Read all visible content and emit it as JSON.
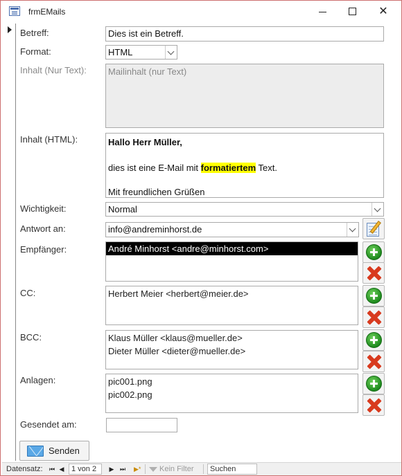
{
  "window": {
    "title": "frmEMails",
    "controls": {
      "minimize": "minimize",
      "maximize": "maximize",
      "close": "✕"
    }
  },
  "form": {
    "betreff": {
      "label": "Betreff:",
      "value": "Dies ist ein Betreff."
    },
    "format": {
      "label": "Format:",
      "value": "HTML"
    },
    "inhalt_text": {
      "label": "Inhalt (Nur Text):",
      "value": "Mailinhalt (nur Text)"
    },
    "inhalt_html": {
      "label": "Inhalt (HTML):",
      "greeting": "Hallo Herr Müller,",
      "body_before": "dies ist eine E-Mail mit ",
      "body_highlight": "formatiertem",
      "body_after": " Text.",
      "closing": "Mit freundlichen Grüßen"
    },
    "wichtigkeit": {
      "label": "Wichtigkeit:",
      "value": "Normal"
    },
    "antwort_an": {
      "label": "Antwort an:",
      "value": "info@andreminhorst.de"
    },
    "empfaenger": {
      "label": "Empfänger:",
      "items": [
        "André Minhorst <andre@minhorst.com>"
      ]
    },
    "cc": {
      "label": "CC:",
      "items": [
        "Herbert Meier <herbert@meier.de>"
      ]
    },
    "bcc": {
      "label": "BCC:",
      "items": [
        "Klaus Müller <klaus@mueller.de>",
        "Dieter Müller <dieter@mueller.de>"
      ]
    },
    "anlagen": {
      "label": "Anlagen:",
      "items": [
        "pic001.png",
        "pic002.png"
      ]
    },
    "gesendet_am": {
      "label": "Gesendet am:",
      "value": ""
    },
    "send_button": "Senden"
  },
  "navigation": {
    "label": "Datensatz:",
    "first": "⏮",
    "prev": "◀",
    "current": "1 von 2",
    "next": "▶",
    "last": "⏭",
    "new": "▶*",
    "filter": "Kein Filter",
    "search": "Suchen"
  },
  "colors": {
    "accent_border": "#cc6f6f",
    "highlight": "#ffff00",
    "selected_row": "#000000"
  }
}
